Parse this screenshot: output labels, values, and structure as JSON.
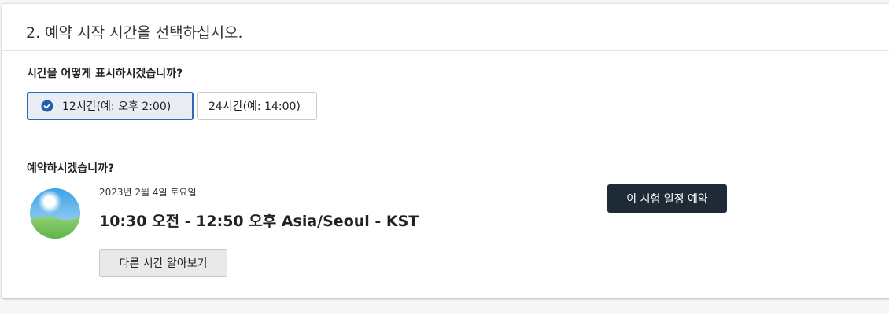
{
  "step": {
    "title": "2. 예약 시작 시간을 선택하십시오."
  },
  "time_format": {
    "question": "시간을 어떻게 표시하시겠습니까?",
    "options": [
      {
        "label": "12시간(예: 오후 2:00)",
        "selected": true
      },
      {
        "label": "24시간(예: 14:00)",
        "selected": false
      }
    ]
  },
  "booking": {
    "question": "예약하시겠습니까?",
    "date": "2023년 2월 4일 토요일",
    "time_range": "10:30 오전 - 12:50 오후 Asia/Seoul - KST",
    "other_times_label": "다른 시간 알아보기",
    "book_label": "이 시험 일정 예약",
    "icon": "daytime-sun-icon"
  },
  "colors": {
    "selected_border": "#2a6ab6",
    "selected_bg": "#e9edf3",
    "primary_button": "#1f2a37",
    "check_icon": "#1f5fb3"
  }
}
